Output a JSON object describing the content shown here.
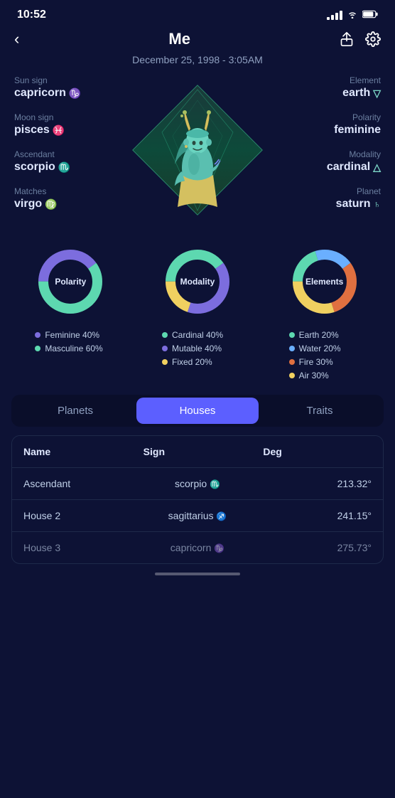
{
  "status": {
    "time": "10:52"
  },
  "header": {
    "title": "Me",
    "back_label": "‹",
    "share_label": "⬆",
    "settings_label": "⚙"
  },
  "subtitle": {
    "date": "December 25, 1998 - 3:05AM"
  },
  "astro_left": [
    {
      "label": "Sun sign",
      "value": "capricorn",
      "symbol": "♑"
    },
    {
      "label": "Moon sign",
      "value": "pisces",
      "symbol": "♓"
    },
    {
      "label": "Ascendant",
      "value": "scorpio",
      "symbol": "♏"
    },
    {
      "label": "Matches",
      "value": "virgo",
      "symbol": "♍"
    }
  ],
  "astro_right": [
    {
      "label": "Element",
      "value": "earth",
      "symbol": "▽"
    },
    {
      "label": "Polarity",
      "value": "feminine",
      "symbol": ""
    },
    {
      "label": "Modality",
      "value": "cardinal",
      "symbol": "△"
    },
    {
      "label": "Planet",
      "value": "saturn",
      "symbol": "♄"
    }
  ],
  "charts": [
    {
      "label": "Polarity",
      "segments": [
        {
          "color": "#7c6dde",
          "pct": 40
        },
        {
          "color": "#5dd8b0",
          "pct": 60
        }
      ],
      "legend": [
        {
          "color": "#7c6dde",
          "text": "Feminine  40%"
        },
        {
          "color": "#5dd8b0",
          "text": "Masculine  60%"
        }
      ]
    },
    {
      "label": "Modality",
      "segments": [
        {
          "color": "#5dd8b0",
          "pct": 40
        },
        {
          "color": "#7c6dde",
          "pct": 40
        },
        {
          "color": "#f0d060",
          "pct": 20
        }
      ],
      "legend": [
        {
          "color": "#5dd8b0",
          "text": "Cardinal  40%"
        },
        {
          "color": "#7c6dde",
          "text": "Mutable  40%"
        },
        {
          "color": "#f0d060",
          "text": "Fixed  20%"
        }
      ]
    },
    {
      "label": "Elements",
      "segments": [
        {
          "color": "#5dd8b0",
          "pct": 20
        },
        {
          "color": "#6aafff",
          "pct": 20
        },
        {
          "color": "#e07040",
          "pct": 30
        },
        {
          "color": "#f0d060",
          "pct": 30
        }
      ],
      "legend": [
        {
          "color": "#5dd8b0",
          "text": "Earth  20%"
        },
        {
          "color": "#6aafff",
          "text": "Water  20%"
        },
        {
          "color": "#e07040",
          "text": "Fire  30%"
        },
        {
          "color": "#f0d060",
          "text": "Air  30%"
        }
      ]
    }
  ],
  "tabs": [
    {
      "id": "planets",
      "label": "Planets",
      "active": false
    },
    {
      "id": "houses",
      "label": "Houses",
      "active": true
    },
    {
      "id": "traits",
      "label": "Traits",
      "active": false
    }
  ],
  "table": {
    "headers": [
      "Name",
      "Sign",
      "Deg"
    ],
    "rows": [
      {
        "name": "Ascendant",
        "sign": "scorpio ♏",
        "deg": "213.32°"
      },
      {
        "name": "House 2",
        "sign": "sagittarius ♐",
        "deg": "241.15°"
      },
      {
        "name": "House 3",
        "sign": "capricorn ♑",
        "deg": "275.73°"
      }
    ]
  }
}
